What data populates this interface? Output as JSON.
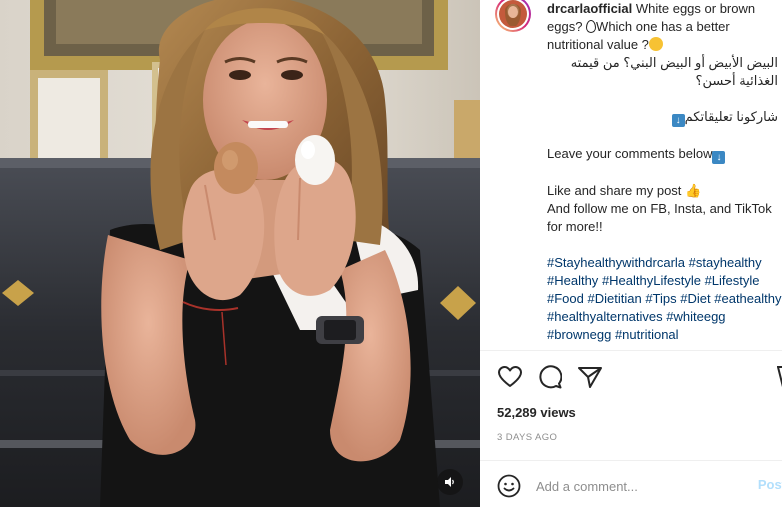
{
  "post": {
    "username": "drcarlaofficial",
    "caption": {
      "line1_text": " White eggs or brown",
      "line2_a": "eggs? ",
      "line2_b": "Which one has a better",
      "line3": "nutritional value ?",
      "arabic1": "البيض الأبيض أو البيض البني؟ من قيمته",
      "arabic2": "الغذائية أحسن؟",
      "arabic3": "شاركونا تعليقاتكم",
      "leave_comments": "Leave your comments below",
      "like_share": "Like and share my post ",
      "follow": "And follow me on FB, Insta, and TikTok",
      "more": "for more!!",
      "hashtags": [
        "#Stayhealthywithdrcarla",
        "#stayhealthy",
        "#Healthy",
        "#HealthyLifestyle",
        "#Lifestyle",
        "#Food",
        "#Dietitian",
        "#Tips",
        "#Diet",
        "#eathealthy",
        "#healthyalternatives",
        "#whiteegg",
        "#brownegg",
        "#nutritional"
      ]
    },
    "icons": {
      "like": "heart-icon",
      "comment": "comment-bubble-icon",
      "share": "paper-plane-icon",
      "save": "bookmark-icon",
      "emoji": "smiley-icon",
      "mute": "speaker-icon"
    },
    "views": "52,289 views",
    "date": "3 DAYS AGO",
    "comment_placeholder": "Add a comment...",
    "post_label": "Post"
  },
  "colors": {
    "hashtag": "#00376b",
    "muted_text": "#8e8e8e",
    "post_button": "#b2dffc",
    "emoji_blue": "#3b88c3"
  }
}
